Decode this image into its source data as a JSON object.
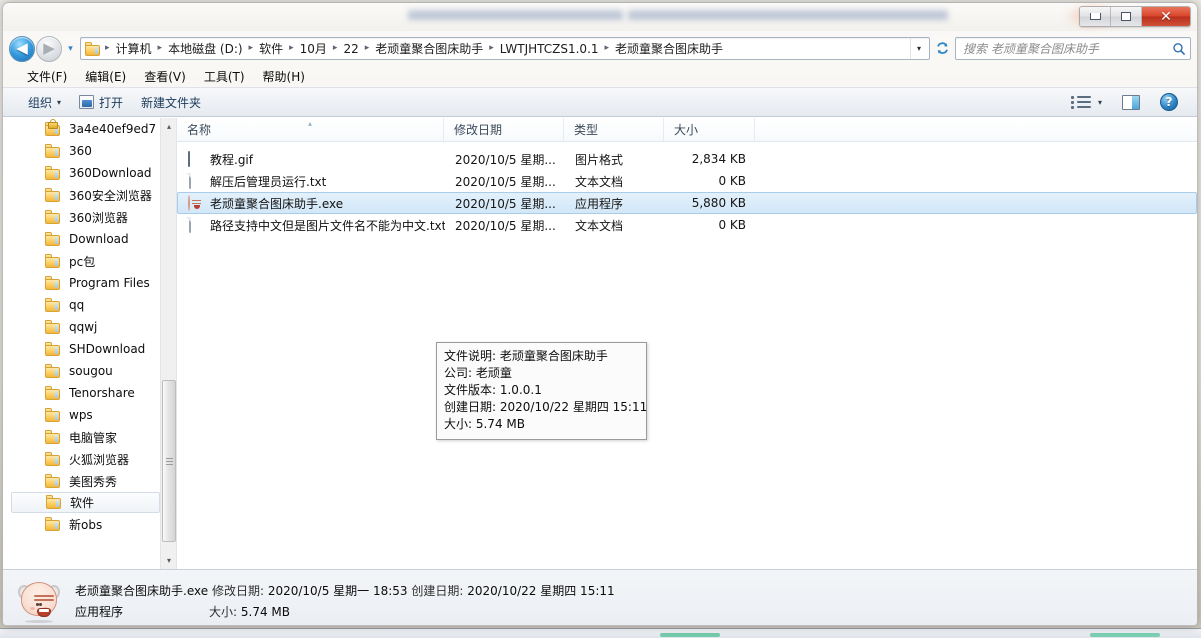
{
  "window": {
    "controls": {
      "minimize": "Minimize",
      "maximize": "Maximize",
      "close": "✕"
    }
  },
  "nav": {
    "back_label": "◀",
    "forward_label": "▶",
    "history_label": "▾",
    "refresh_label": "↻",
    "dropdown_label": "▾",
    "breadcrumbs": [
      "计算机",
      "本地磁盘 (D:)",
      "软件",
      "10月",
      "22",
      "老顽童聚合图床助手",
      "LWTJHTCZS1.0.1",
      "老顽童聚合图床助手"
    ],
    "separator": "▸"
  },
  "search": {
    "placeholder": "搜索 老顽童聚合图床助手",
    "icon": "search-icon"
  },
  "menubar": {
    "items": [
      {
        "text": "文件(F)",
        "label": "文件",
        "key": "F"
      },
      {
        "text": "编辑(E)",
        "label": "编辑",
        "key": "E"
      },
      {
        "text": "查看(V)",
        "label": "查看",
        "key": "V"
      },
      {
        "text": "工具(T)",
        "label": "工具",
        "key": "T"
      },
      {
        "text": "帮助(H)",
        "label": "帮助",
        "key": "H"
      }
    ]
  },
  "toolbar": {
    "organize": "组织",
    "organize_caret": "▾",
    "open": "打开",
    "new_folder": "新建文件夹",
    "views_caret": "▾",
    "help_glyph": "?"
  },
  "navpane": {
    "items": [
      {
        "label": "3a4e40ef9ed7",
        "locked": true
      },
      {
        "label": "360",
        "locked": false
      },
      {
        "label": "360Download",
        "locked": false
      },
      {
        "label": "360安全浏览器",
        "locked": false
      },
      {
        "label": "360浏览器",
        "locked": false
      },
      {
        "label": "Download",
        "locked": false
      },
      {
        "label": "pc包",
        "locked": false
      },
      {
        "label": "Program Files",
        "locked": false
      },
      {
        "label": "qq",
        "locked": false
      },
      {
        "label": "qqwj",
        "locked": false
      },
      {
        "label": "SHDownload",
        "locked": false
      },
      {
        "label": "sougou",
        "locked": false
      },
      {
        "label": "Tenorshare",
        "locked": false
      },
      {
        "label": "wps",
        "locked": false
      },
      {
        "label": "电脑管家",
        "locked": false
      },
      {
        "label": "火狐浏览器",
        "locked": false
      },
      {
        "label": "美图秀秀",
        "locked": false
      },
      {
        "label": "软件",
        "locked": false,
        "selected": true
      },
      {
        "label": "新obs",
        "locked": false
      }
    ],
    "scroll_up": "▴",
    "scroll_down": "▾"
  },
  "filelist": {
    "columns": [
      {
        "key": "name",
        "label": "名称",
        "sorted": true,
        "sort_mark": "▴"
      },
      {
        "key": "date",
        "label": "修改日期"
      },
      {
        "key": "type",
        "label": "类型"
      },
      {
        "key": "size",
        "label": "大小"
      }
    ],
    "rows": [
      {
        "name": "教程.gif",
        "date": "2020/10/5 星期...",
        "type": "图片格式",
        "size": "2,834 KB",
        "icon": "gif-file-icon",
        "selected": false
      },
      {
        "name": "解压后管理员运行.txt",
        "date": "2020/10/5 星期...",
        "type": "文本文档",
        "size": "0 KB",
        "icon": "text-file-icon",
        "selected": false
      },
      {
        "name": "老顽童聚合图床助手.exe",
        "date": "2020/10/5 星期...",
        "type": "应用程序",
        "size": "5,880 KB",
        "icon": "exe-file-icon",
        "selected": true
      },
      {
        "name": "路径支持中文但是图片文件名不能为中文.txt",
        "date": "2020/10/5 星期...",
        "type": "文本文档",
        "size": "0 KB",
        "icon": "text-file-icon",
        "selected": false
      }
    ]
  },
  "tooltip": {
    "lines": [
      "文件说明: 老顽童聚合图床助手",
      "公司: 老顽童",
      "文件版本: 1.0.0.1",
      "创建日期: 2020/10/22 星期四 15:11",
      "大小: 5.74 MB"
    ]
  },
  "statusbar": {
    "filename": "老顽童聚合图床助手.exe",
    "modified_label": "修改日期:",
    "modified_value": "2020/10/5 星期一 18:53",
    "created_label": "创建日期:",
    "created_value": "2020/10/22 星期四 15:11",
    "type_value": "应用程序",
    "size_label": "大小:",
    "size_value": "5.74 MB",
    "icon": "app-face-icon"
  },
  "colors": {
    "selection_fill": "#d2e7f8",
    "selection_border": "#a9cce8",
    "close_button": "#d9452c",
    "folder_yellow": "#fdcd62",
    "accent_blue": "#2e86c8"
  }
}
